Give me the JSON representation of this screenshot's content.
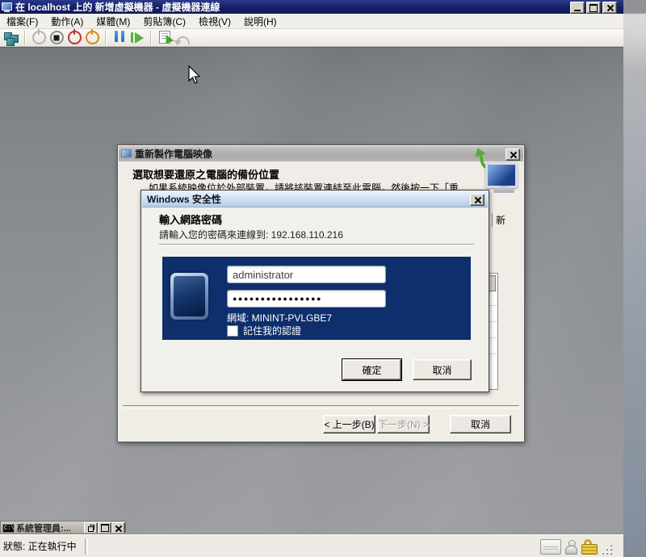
{
  "window_title": "在 localhost 上的 新增虛擬機器 - 虛擬機器連線",
  "menu": {
    "items": [
      "檔案(F)",
      "動作(A)",
      "媒體(M)",
      "剪貼簿(C)",
      "檢視(V)",
      "說明(H)"
    ]
  },
  "reimage_dialog": {
    "title": "重新製作電腦映像",
    "heading": "選取想要還原之電腦的備份位置",
    "description": "如果系統映像位於外部裝置，請將該裝置連結至此電腦，然後按一下「重",
    "clipped_text": "新",
    "back_button": "< 上一步(B)",
    "next_button": "下一步(N) >",
    "cancel_button": "取消"
  },
  "security_dialog": {
    "title": "Windows 安全性",
    "heading": "輸入網路密碼",
    "message": "請輸入您的密碼來連線到: 192.168.110.216",
    "username": "administrator",
    "password_mask": "●●●●●●●●●●●●●●●●",
    "domain": "網域: MININT-PVLGBE7",
    "remember_label": "記住我的認證",
    "ok_button": "確定",
    "cancel_button": "取消"
  },
  "cmd_window": {
    "title": "系統管理員:...",
    "icon_label": "C:\\"
  },
  "status_bar": {
    "text": "狀態: 正在執行中"
  },
  "colors": {
    "titlebar_navy": "#141f66",
    "credential_panel_navy": "#0e2f6c",
    "security_titlebar_blue": "#cfe0f2",
    "dialog_body": "#f0ede6",
    "lock_gold": "#caa41e"
  }
}
